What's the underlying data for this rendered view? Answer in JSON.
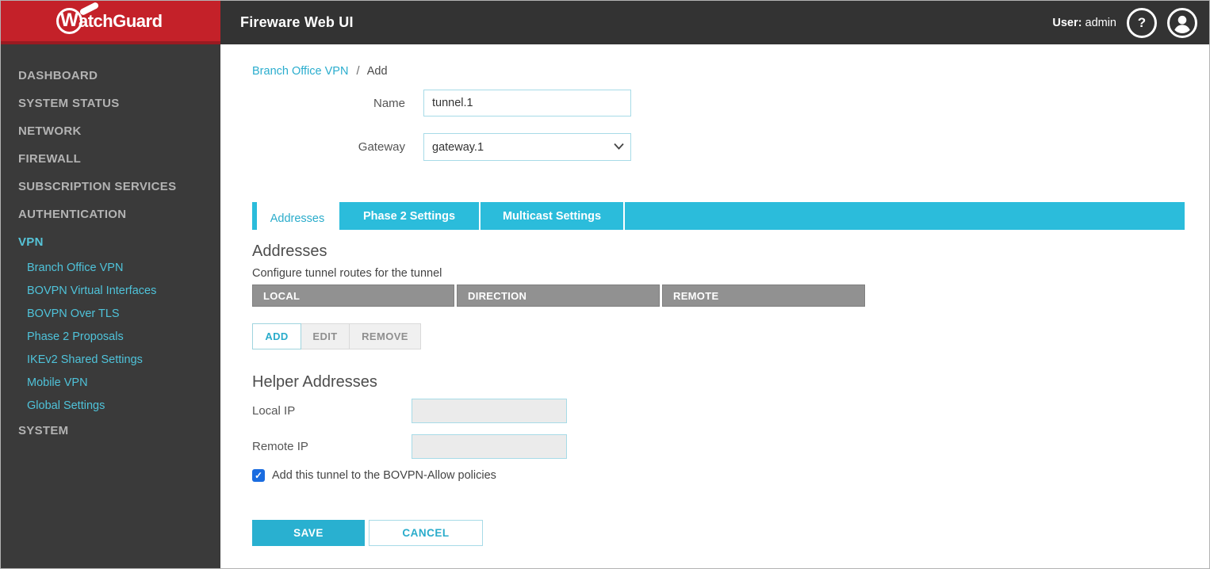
{
  "header": {
    "brand_w": "W",
    "brand_rest": "atchGuard",
    "app_title": "Fireware Web UI",
    "user_label": "User:",
    "user_name": "admin",
    "help_glyph": "?"
  },
  "sidebar": {
    "items": [
      {
        "label": "DASHBOARD"
      },
      {
        "label": "SYSTEM STATUS"
      },
      {
        "label": "NETWORK"
      },
      {
        "label": "FIREWALL"
      },
      {
        "label": "SUBSCRIPTION SERVICES"
      },
      {
        "label": "AUTHENTICATION"
      },
      {
        "label": "VPN"
      }
    ],
    "vpn_subitems": [
      {
        "label": "Branch Office VPN"
      },
      {
        "label": "BOVPN Virtual Interfaces"
      },
      {
        "label": "BOVPN Over TLS"
      },
      {
        "label": "Phase 2 Proposals"
      },
      {
        "label": "IKEv2 Shared Settings"
      },
      {
        "label": "Mobile VPN"
      },
      {
        "label": "Global Settings"
      }
    ],
    "items_after": [
      {
        "label": "SYSTEM"
      }
    ]
  },
  "breadcrumb": {
    "parent": "Branch Office VPN",
    "separator": "/",
    "current": "Add"
  },
  "form": {
    "name_label": "Name",
    "name_value": "tunnel.1",
    "gateway_label": "Gateway",
    "gateway_value": "gateway.1"
  },
  "tabs": [
    {
      "label": "Addresses",
      "active": true
    },
    {
      "label": "Phase 2 Settings",
      "active": false
    },
    {
      "label": "Multicast Settings",
      "active": false
    }
  ],
  "addresses": {
    "heading": "Addresses",
    "description": "Configure tunnel routes for the tunnel",
    "table": {
      "columns": [
        "LOCAL",
        "DIRECTION",
        "REMOTE"
      ],
      "rows": []
    },
    "buttons": {
      "add": "ADD",
      "edit": "EDIT",
      "remove": "REMOVE"
    }
  },
  "helper": {
    "heading": "Helper Addresses",
    "local_ip_label": "Local IP",
    "local_ip_value": "",
    "remote_ip_label": "Remote IP",
    "remote_ip_value": "",
    "checkbox_checked": true,
    "checkbox_label": "Add this tunnel to the BOVPN-Allow policies"
  },
  "actions": {
    "save": "SAVE",
    "cancel": "CANCEL"
  },
  "colors": {
    "brand_red": "#c42129",
    "accent_cyan": "#2bbcdb",
    "link_cyan": "#2aadce",
    "save_cyan": "#29b0d0",
    "sidebar_bg": "#3a3a3a",
    "topbar_bg": "#333333",
    "table_header_gray": "#919191",
    "checkbox_blue": "#1a6ce0"
  }
}
